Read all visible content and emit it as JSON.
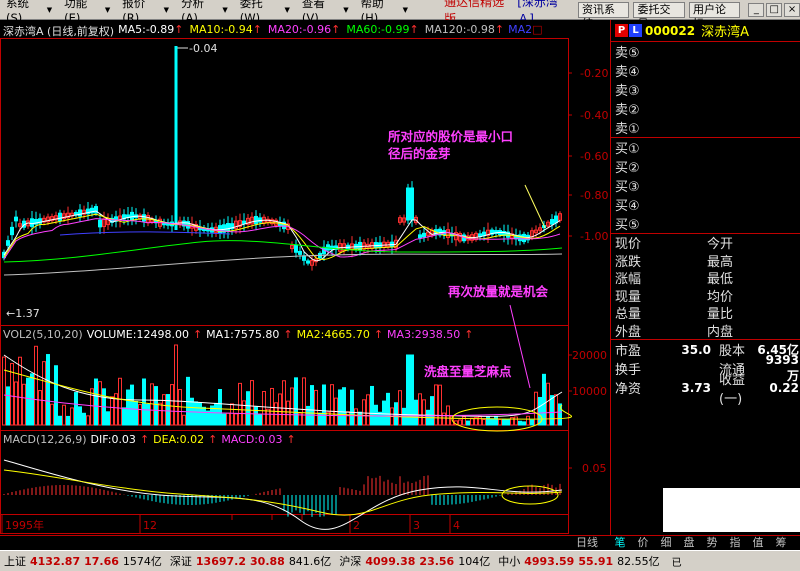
{
  "menu": {
    "items": [
      {
        "label": "系统(S)"
      },
      {
        "label": "功能(E)"
      },
      {
        "label": "报价(R)"
      },
      {
        "label": "分析(A)"
      },
      {
        "label": "委托(W)"
      },
      {
        "label": "查看(V)"
      },
      {
        "label": "帮助(H)"
      }
    ],
    "app_title": "通达信精选版",
    "app_subtitle": "[深赤湾Ａ]",
    "buttons": [
      "资讯系统",
      "委托交易",
      "用户论坛"
    ],
    "window_controls": [
      "_",
      "□",
      "×"
    ]
  },
  "price_panel": {
    "title": "深赤湾A (日线,前复权)",
    "mas": [
      {
        "label": "MA5:-0.89",
        "color": "#ffffff"
      },
      {
        "label": "MA10:-0.94",
        "color": "#ffff00"
      },
      {
        "label": "MA20:-0.96",
        "color": "#ff40ff"
      },
      {
        "label": "MA60:-0.99",
        "color": "#00ff00"
      },
      {
        "label": "MA120:-0.98",
        "color": "#c0c0c0"
      }
    ],
    "ma_extra": "MA2",
    "ma_extra_color": "#4040ff",
    "ma_extra_suffix": "□",
    "high_label": "-0.04",
    "low_label": "1.37",
    "y_ticks": [
      "-0.20",
      "-0.40",
      "-0.60",
      "-0.80",
      "-1.00"
    ]
  },
  "volume_panel": {
    "labels": [
      {
        "text": "VOL2(5,10,20)",
        "color": "#c0c0c0"
      },
      {
        "text": "VOLUME:12498.00",
        "color": "#ffffff"
      },
      {
        "text": "MA1:7575.80",
        "color": "#ffffff"
      },
      {
        "text": "MA2:4665.70",
        "color": "#ffff00"
      },
      {
        "text": "MA3:2938.50",
        "color": "#ff40ff"
      }
    ],
    "y_ticks": [
      "20000",
      "10000"
    ]
  },
  "macd_panel": {
    "labels": [
      {
        "text": "MACD(12,26,9)",
        "color": "#c0c0c0"
      },
      {
        "text": "DIF:0.03",
        "color": "#ffffff"
      },
      {
        "text": "DEA:0.02",
        "color": "#ffff00"
      },
      {
        "text": "MACD:0.03",
        "color": "#ff40ff"
      }
    ],
    "y_ticks": [
      "0.05"
    ]
  },
  "x_axis": {
    "labels": [
      "1995年",
      "12",
      "2",
      "3",
      "4"
    ]
  },
  "annotations": [
    {
      "lines": [
        "所对应的股价是最小口",
        "径后的金芽"
      ]
    },
    {
      "lines": [
        "再次放量就是机会"
      ]
    },
    {
      "lines": [
        "洗盘至量芝麻点"
      ]
    }
  ],
  "stock": {
    "badges": [
      {
        "text": "P",
        "color": "#e00000"
      },
      {
        "text": "L",
        "color": "#2040ff"
      }
    ],
    "code": "000022",
    "name": "深赤湾A"
  },
  "order_book": {
    "sell": [
      "卖⑤",
      "卖④",
      "卖③",
      "卖②",
      "卖①"
    ],
    "buy": [
      "买①",
      "买②",
      "买③",
      "买④",
      "买⑤"
    ]
  },
  "quote": {
    "rows": [
      [
        "现价",
        "今开"
      ],
      [
        "涨跌",
        "最高"
      ],
      [
        "涨幅",
        "最低"
      ],
      [
        "现量",
        "均价"
      ],
      [
        "总量",
        "量比"
      ],
      [
        "外盘",
        "内盘"
      ]
    ]
  },
  "fundamentals": {
    "rows": [
      {
        "k1": "市盈",
        "v1": "35.0",
        "k2": "股本",
        "v2": "6.45亿"
      },
      {
        "k1": "换手",
        "v1": "",
        "k2": "流通",
        "v2": "9393万"
      },
      {
        "k1": "净资",
        "v1": "3.73",
        "k2": "收益(一)",
        "v2": "0.22"
      }
    ]
  },
  "bottom_tabs": {
    "daily": "日线",
    "tabs": [
      "笔",
      "价",
      "细",
      "盘",
      "势",
      "指",
      "值",
      "筹"
    ]
  },
  "status_bar": {
    "segments": [
      {
        "name": "上证",
        "value": "4132.87",
        "change": "17.66",
        "volume": "1574亿"
      },
      {
        "name": "深证",
        "value": "13697.2",
        "change": "30.88",
        "volume": "841.6亿"
      },
      {
        "name": "沪深",
        "value": "4099.38",
        "change": "23.56",
        "volume": "104亿"
      },
      {
        "name": "中小",
        "value": "4993.59",
        "change": "55.91",
        "volume": "82.55亿"
      }
    ],
    "extra": "已"
  }
}
